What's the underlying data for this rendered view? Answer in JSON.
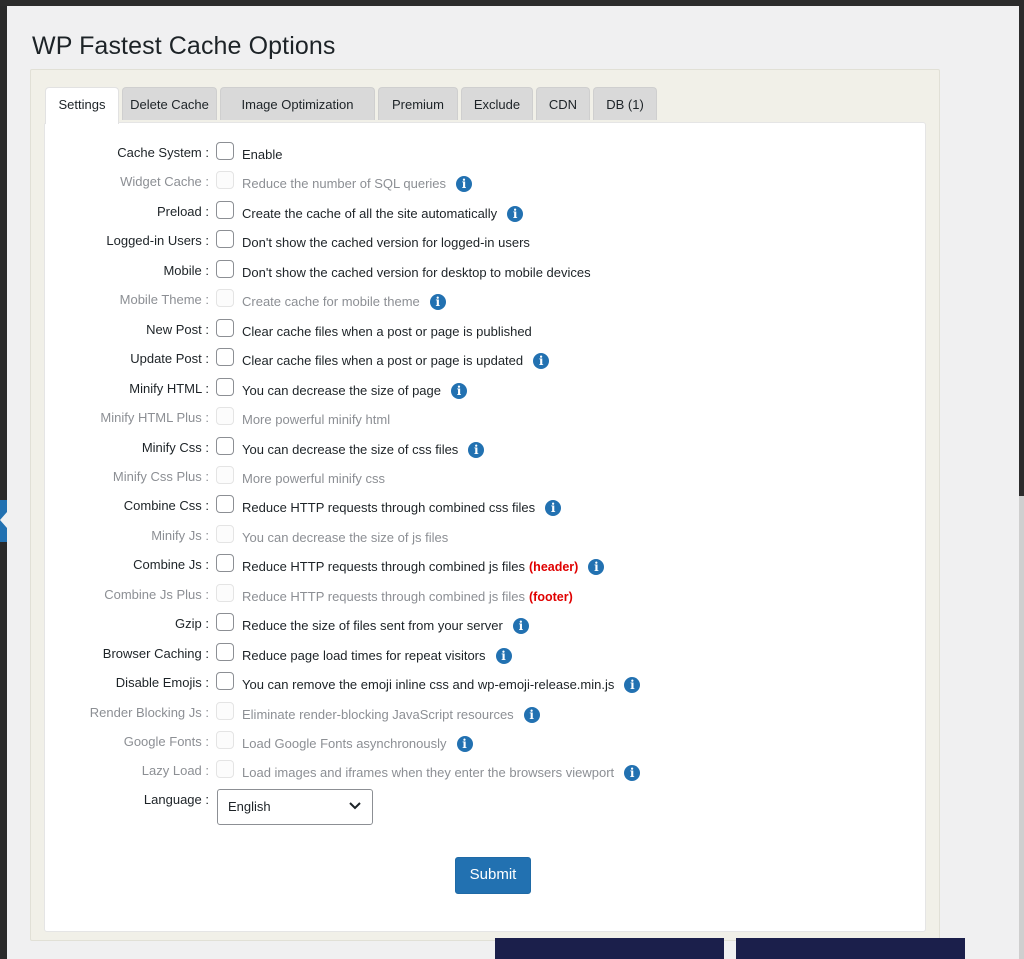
{
  "page": {
    "title": "WP Fastest Cache Options"
  },
  "tabs": [
    {
      "label": "Settings",
      "active": true
    },
    {
      "label": "Delete Cache"
    },
    {
      "label": "Image Optimization"
    },
    {
      "label": "Premium"
    },
    {
      "label": "Exclude"
    },
    {
      "label": "CDN"
    },
    {
      "label": "DB (1)"
    }
  ],
  "options": [
    {
      "label": "Cache System :",
      "desc": "Enable",
      "info": false,
      "disabled": false
    },
    {
      "label": "Widget Cache :",
      "desc": "Reduce the number of SQL queries",
      "info": true,
      "disabled": true
    },
    {
      "label": "Preload :",
      "desc": "Create the cache of all the site automatically",
      "info": true,
      "disabled": false
    },
    {
      "label": "Logged-in Users :",
      "desc": "Don't show the cached version for logged-in users",
      "info": false,
      "disabled": false
    },
    {
      "label": "Mobile :",
      "desc": "Don't show the cached version for desktop to mobile devices",
      "info": false,
      "disabled": false
    },
    {
      "label": "Mobile Theme :",
      "desc": "Create cache for mobile theme",
      "info": true,
      "disabled": true
    },
    {
      "label": "New Post :",
      "desc": "Clear cache files when a post or page is published",
      "info": false,
      "disabled": false
    },
    {
      "label": "Update Post :",
      "desc": "Clear cache files when a post or page is updated",
      "info": true,
      "disabled": false
    },
    {
      "label": "Minify HTML :",
      "desc": "You can decrease the size of page",
      "info": true,
      "disabled": false
    },
    {
      "label": "Minify HTML Plus :",
      "desc": "More powerful minify html",
      "info": false,
      "disabled": true
    },
    {
      "label": "Minify Css :",
      "desc": "You can decrease the size of css files",
      "info": true,
      "disabled": false
    },
    {
      "label": "Minify Css Plus :",
      "desc": "More powerful minify css",
      "info": false,
      "disabled": true
    },
    {
      "label": "Combine Css :",
      "desc": "Reduce HTTP requests through combined css files",
      "info": true,
      "disabled": false
    },
    {
      "label": "Minify Js :",
      "desc": "You can decrease the size of js files",
      "info": false,
      "disabled": true
    },
    {
      "label": "Combine Js :",
      "desc": "Reduce HTTP requests through combined js files",
      "tag": "(header)",
      "info": true,
      "disabled": false
    },
    {
      "label": "Combine Js Plus :",
      "desc": "Reduce HTTP requests through combined js files",
      "tag": "(footer)",
      "info": false,
      "disabled": true
    },
    {
      "label": "Gzip :",
      "desc": "Reduce the size of files sent from your server",
      "info": true,
      "disabled": false
    },
    {
      "label": "Browser Caching :",
      "desc": "Reduce page load times for repeat visitors",
      "info": true,
      "disabled": false
    },
    {
      "label": "Disable Emojis :",
      "desc": "You can remove the emoji inline css and wp-emoji-release.min.js",
      "info": true,
      "disabled": false
    },
    {
      "label": "Render Blocking Js :",
      "desc": "Eliminate render-blocking JavaScript resources",
      "info": true,
      "disabled": true
    },
    {
      "label": "Google Fonts :",
      "desc": "Load Google Fonts asynchronously",
      "info": true,
      "disabled": true
    },
    {
      "label": "Lazy Load :",
      "desc": "Load images and iframes when they enter the browsers viewport",
      "info": true,
      "disabled": true
    }
  ],
  "language": {
    "label": "Language :",
    "value": "English"
  },
  "submit": {
    "label": "Submit"
  },
  "colors": {
    "accent": "#2271b1",
    "tag": "#e00000",
    "navy": "#1b1f4b"
  }
}
